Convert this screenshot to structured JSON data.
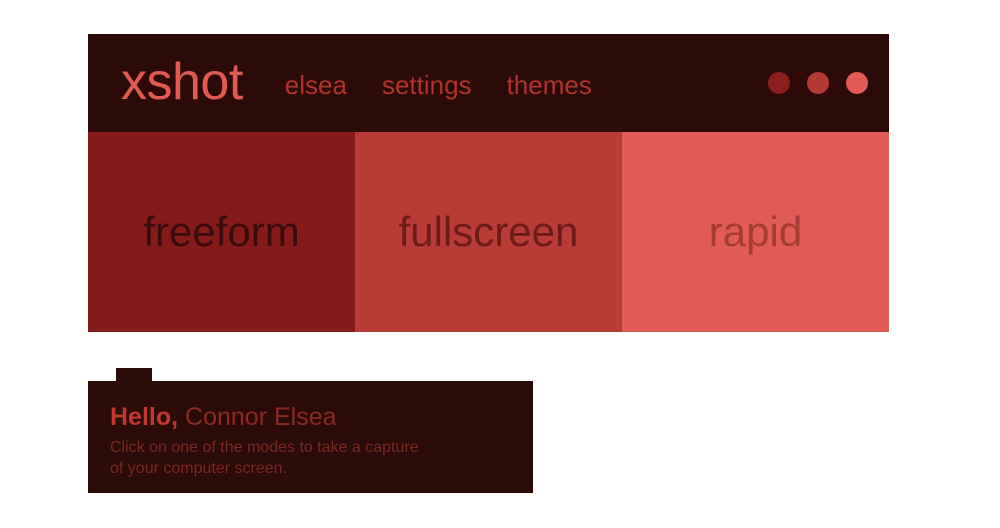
{
  "app": {
    "logo": "xshot",
    "titlebar_bg": "#2b0a08",
    "logo_color": "#e05a52"
  },
  "nav": {
    "items": [
      {
        "label": "elsea"
      },
      {
        "label": "settings"
      },
      {
        "label": "themes"
      }
    ]
  },
  "window_controls": {
    "dots": [
      {
        "name": "dot-dark",
        "color": "#8a1f1c"
      },
      {
        "name": "dot-medium",
        "color": "#b53a34"
      },
      {
        "name": "dot-light",
        "color": "#e25a54"
      }
    ]
  },
  "modes": {
    "tiles": [
      {
        "label": "freeform",
        "bg": "#861c1a",
        "text_color": "#3a0d0c"
      },
      {
        "label": "fullscreen",
        "bg": "#b93b36",
        "text_color": "#6e1a17"
      },
      {
        "label": "rapid",
        "bg": "#e25a54",
        "text_color": "#a63a35"
      }
    ]
  },
  "greeting_card": {
    "hello": "Hello,",
    "name": "Connor Elsea",
    "body_line_1": "Click on one of the modes to take a capture",
    "body_line_2": "of your computer screen.",
    "bg": "#2b0a08"
  }
}
